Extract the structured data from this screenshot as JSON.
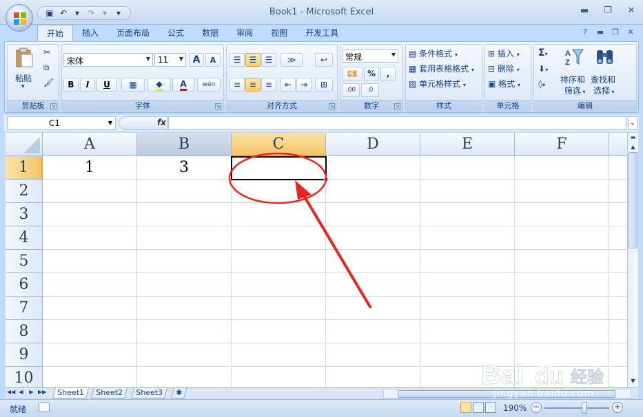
{
  "app": {
    "title": "Book1 - Microsoft Excel"
  },
  "qat": {
    "save": "▣",
    "undo": "↶",
    "undo_dd": "▾",
    "redo": "↷",
    "redo_dd": "▾",
    "customize": "▾"
  },
  "window": {
    "minimize": "▬",
    "restore": "❐",
    "close": "✕"
  },
  "tabs": [
    {
      "label": "开始"
    },
    {
      "label": "插入"
    },
    {
      "label": "页面布局"
    },
    {
      "label": "公式"
    },
    {
      "label": "数据"
    },
    {
      "label": "审阅"
    },
    {
      "label": "视图"
    },
    {
      "label": "开发工具"
    }
  ],
  "tab_right": {
    "help": "?",
    "min": "▬",
    "restore": "❐",
    "close": "✕"
  },
  "ribbon": {
    "clipboard": {
      "label": "剪贴板",
      "paste": "粘贴",
      "paste_dd": "▾"
    },
    "font": {
      "label": "字体",
      "font_name": "宋体",
      "font_size": "11",
      "grow": "A",
      "shrink": "A",
      "bold": "B",
      "italic": "I",
      "underline": "U",
      "font_color": "A",
      "phonetic": "wén"
    },
    "alignment": {
      "label": "对齐方式"
    },
    "number": {
      "label": "数字",
      "format": "常规",
      "percent": "%",
      "comma": ",",
      "inc_decimal": ".00",
      "dec_decimal": ".0"
    },
    "styles": {
      "label": "样式",
      "conditional": "条件格式",
      "table": "套用表格格式",
      "cell": "单元格样式"
    },
    "cells": {
      "label": "单元格",
      "insert": "插入",
      "delete": "删除",
      "format": "格式"
    },
    "editing": {
      "label": "编辑",
      "sigma": "Σ",
      "sort_line1": "排序和",
      "sort_line2": "筛选",
      "find_line1": "查找和",
      "find_line2": "选择"
    }
  },
  "formula_bar": {
    "name_box": "C1",
    "fx": "fx",
    "formula": ""
  },
  "grid": {
    "columns": [
      "A",
      "B",
      "C",
      "D",
      "E",
      "F"
    ],
    "rows": [
      "1",
      "2",
      "3",
      "4",
      "5",
      "6",
      "7",
      "8",
      "9",
      "10"
    ],
    "cells": {
      "A1": "1",
      "B1": "3",
      "C1": ""
    },
    "selected_cell": "C1"
  },
  "sheets": [
    {
      "label": "Sheet1"
    },
    {
      "label": "Sheet2"
    },
    {
      "label": "Sheet3"
    }
  ],
  "sheet_nav": {
    "first": "◀◀",
    "prev": "◀",
    "next": "▶",
    "last": "▶▶"
  },
  "status": {
    "ready": "就绪",
    "zoom": "190%",
    "zoom_minus": "−",
    "zoom_plus": "+"
  },
  "watermark": {
    "brand": "Bai",
    "brand2": "du",
    "cn": "经验",
    "url": "jingyan.baidu.com"
  },
  "colors": {
    "accent": "#15428b",
    "selection": "#f5c46c",
    "annotation": "#e8261b"
  }
}
